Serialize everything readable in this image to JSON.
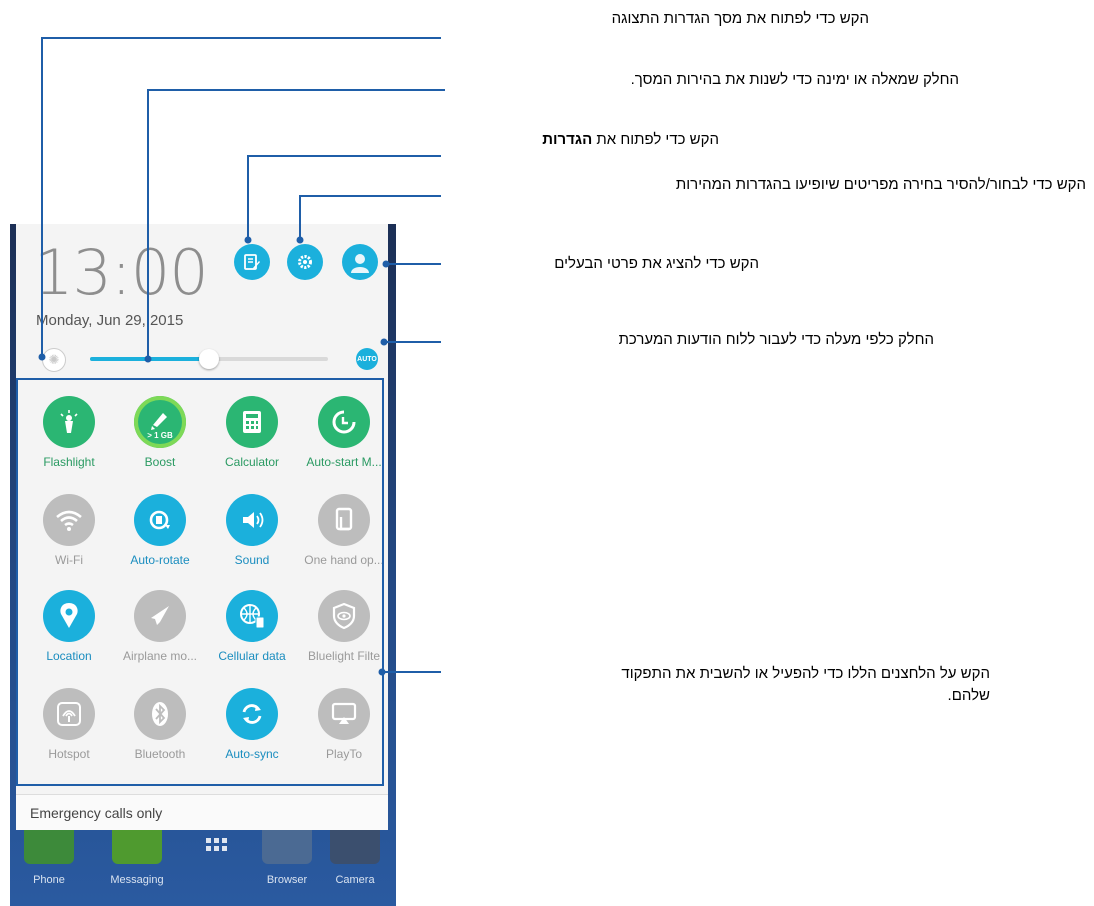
{
  "phone": {
    "clock": "13:00",
    "date": "Monday, Jun 29, 2015",
    "brightness_level": 0.5,
    "brightness_auto_label": "AUTO",
    "emergency": "Emergency calls only",
    "tiles": [
      {
        "label": "Flashlight",
        "icon": "flashlight-icon",
        "state": "green"
      },
      {
        "label": "Boost",
        "icon": "boost-icon",
        "state": "green",
        "badge": "> 1 GB"
      },
      {
        "label": "Calculator",
        "icon": "calculator-icon",
        "state": "green"
      },
      {
        "label": "Auto-start M...",
        "icon": "auto-start-icon",
        "state": "green"
      },
      {
        "label": "Wi-Fi",
        "icon": "wifi-icon",
        "state": "off"
      },
      {
        "label": "Auto-rotate",
        "icon": "rotate-icon",
        "state": "on"
      },
      {
        "label": "Sound",
        "icon": "sound-icon",
        "state": "on"
      },
      {
        "label": "One hand op...",
        "icon": "one-hand-icon",
        "state": "off"
      },
      {
        "label": "Location",
        "icon": "location-icon",
        "state": "on"
      },
      {
        "label": "Airplane mo...",
        "icon": "airplane-icon",
        "state": "off"
      },
      {
        "label": "Cellular data",
        "icon": "cellular-data-icon",
        "state": "on"
      },
      {
        "label": "Bluelight Filte",
        "icon": "bluelight-icon",
        "state": "off"
      },
      {
        "label": "Hotspot",
        "icon": "hotspot-icon",
        "state": "off"
      },
      {
        "label": "Bluetooth",
        "icon": "bluetooth-icon",
        "state": "off"
      },
      {
        "label": "Auto-sync",
        "icon": "sync-icon",
        "state": "on"
      },
      {
        "label": "PlayTo",
        "icon": "playto-icon",
        "state": "off"
      }
    ],
    "dock": [
      {
        "label": "Phone",
        "icon": "phone-icon"
      },
      {
        "label": "Messaging",
        "icon": "messaging-icon"
      },
      {
        "label": "",
        "icon": "apps-grid-icon"
      },
      {
        "label": "Browser",
        "icon": "browser-icon"
      },
      {
        "label": "Camera",
        "icon": "camera-icon"
      }
    ]
  },
  "callouts": {
    "display_settings": "הקש כדי לפתוח את מסך הגדרות התצוגה",
    "brightness": "החלק שמאלה או ימינה כדי לשנות את בהירות המסך.",
    "settings_prefix": "הקש כדי לפתוח את ",
    "settings_bold": "הגדרות",
    "quick_settings": "הקש כדי לבחור/להסיר בחירה מפריטים שיופיעו בהגדרות המהירות",
    "owner": "הקש כדי להציג את פרטי הבעלים",
    "swipe_up": "החלק כלפי מעלה כדי לעבור ללוח הודעות המערכת",
    "toggle_line1": "הקש על הלחצנים הללו כדי להפעיל או להשבית את התפקוד",
    "toggle_line2": "שלהם."
  }
}
